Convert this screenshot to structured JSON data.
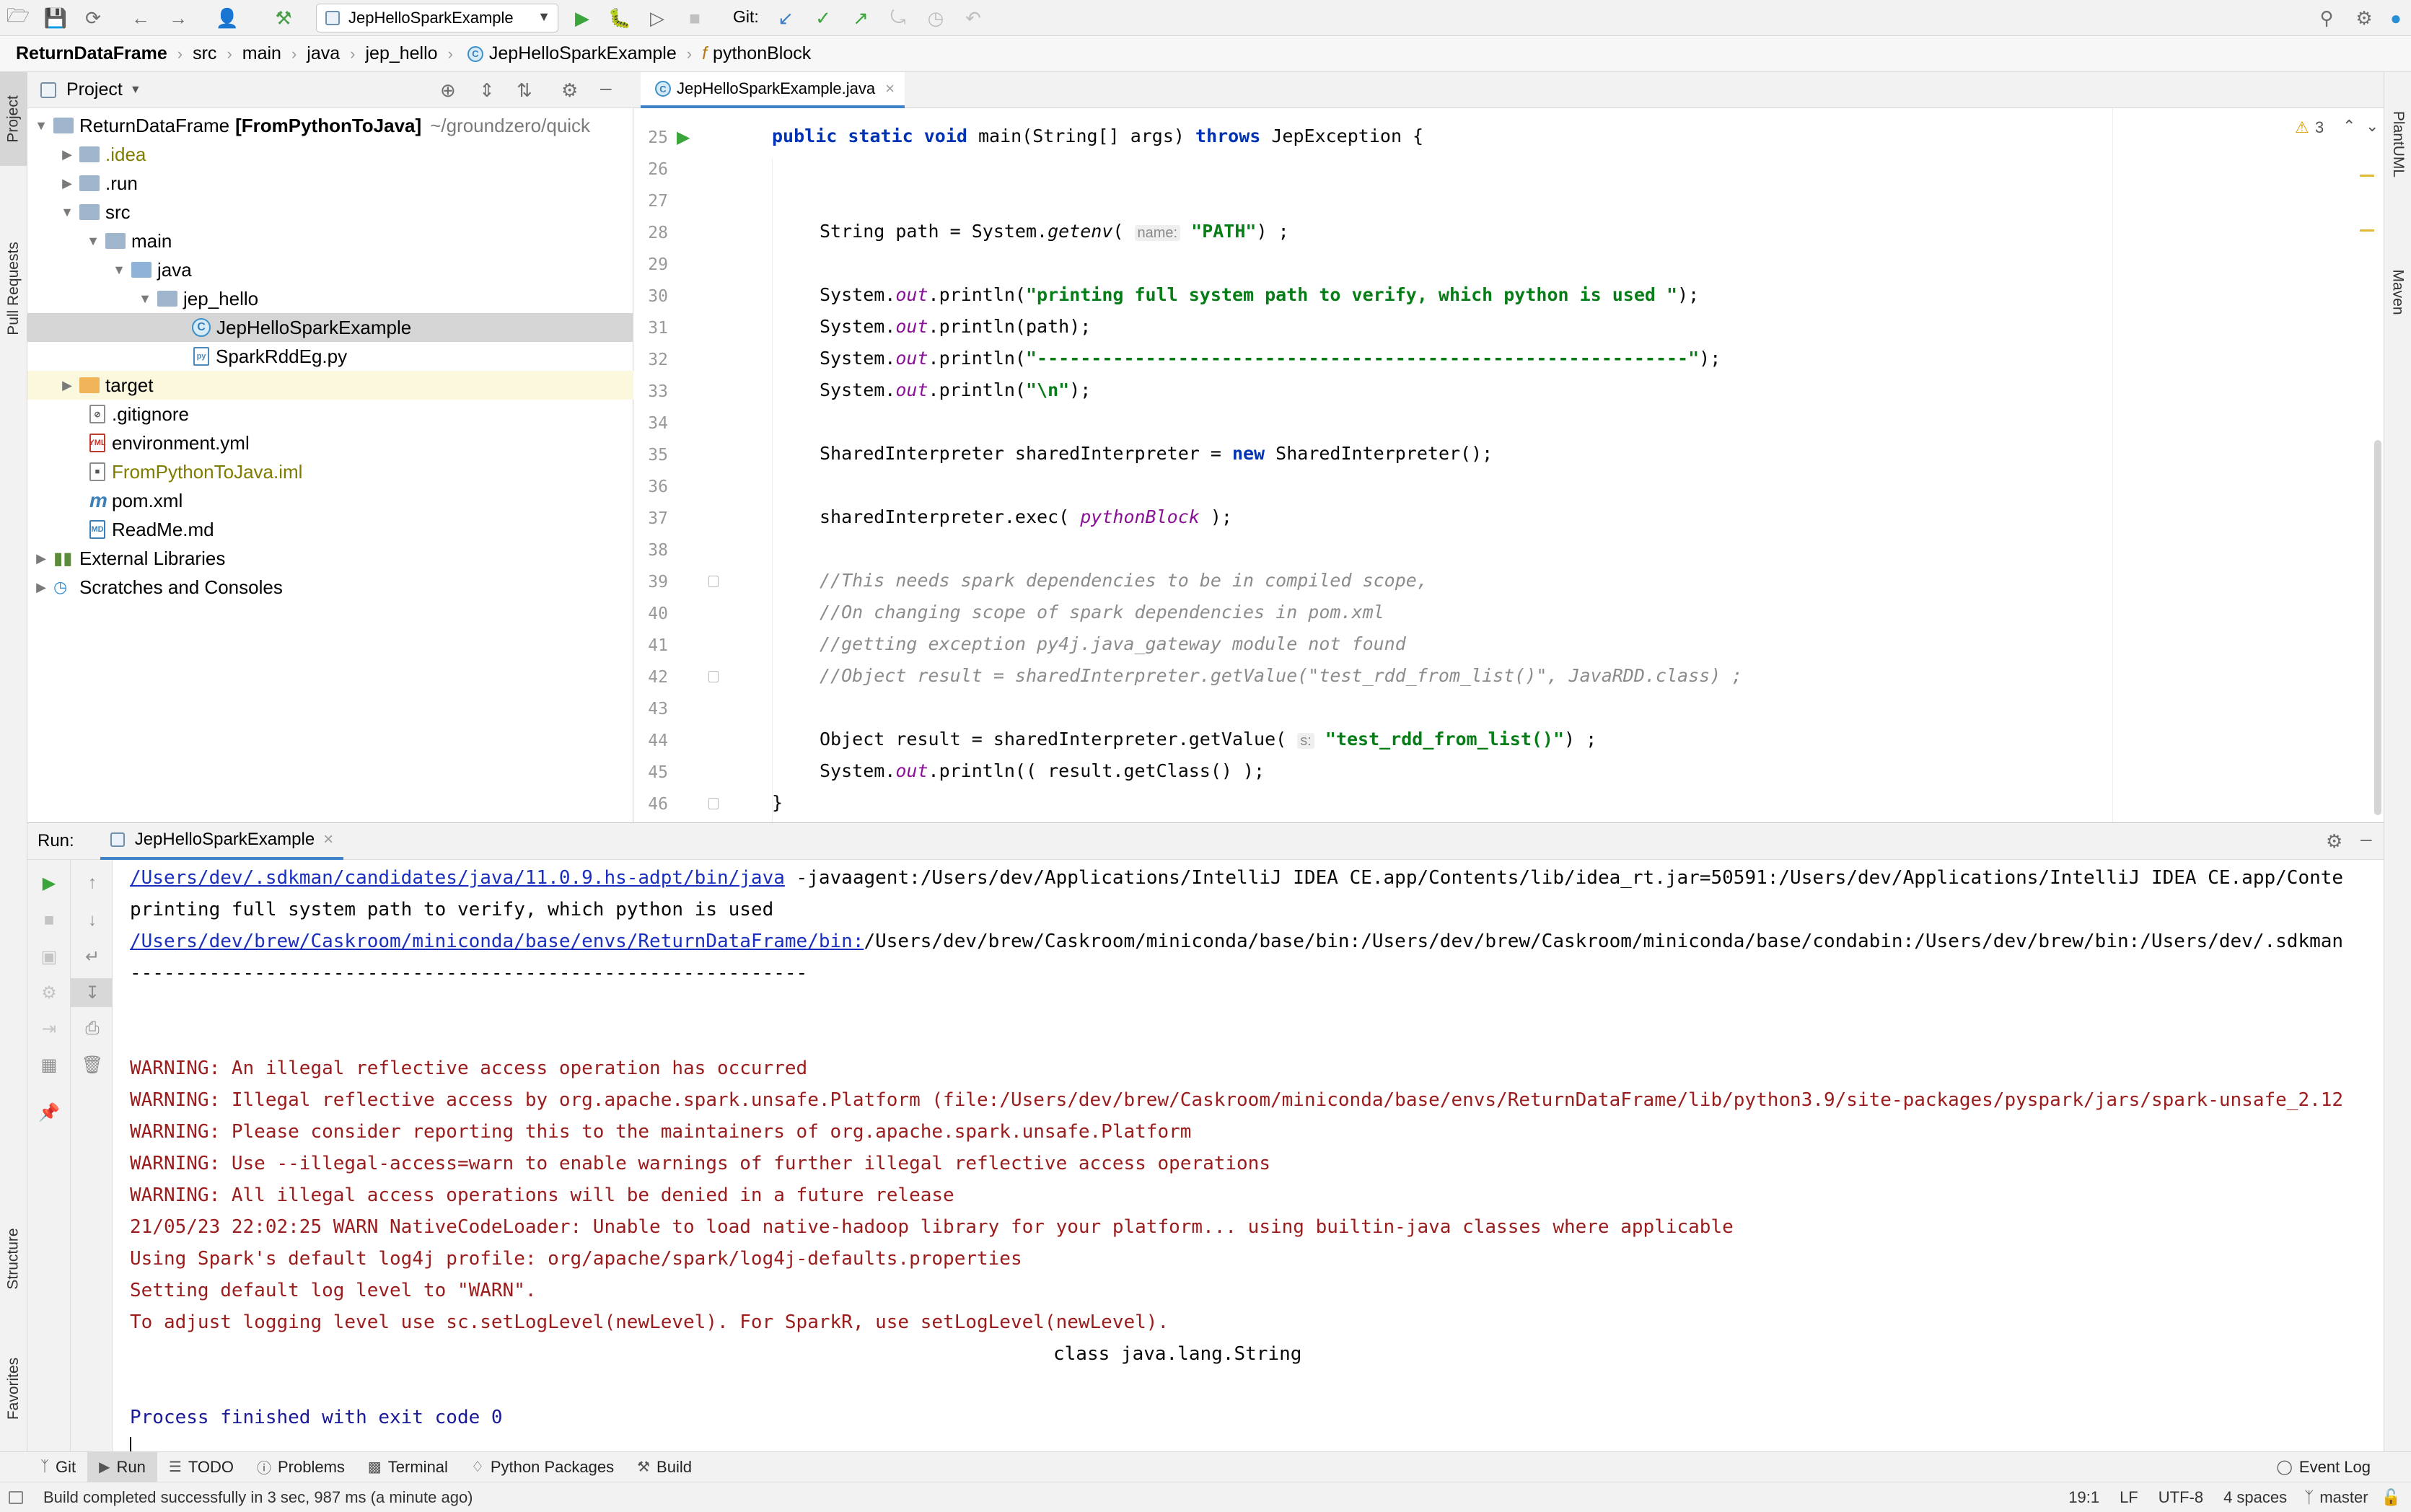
{
  "toolbar": {
    "run_config": "JepHelloSparkExample",
    "git_label": "Git:"
  },
  "breadcrumb": [
    "ReturnDataFrame",
    "src",
    "main",
    "java",
    "jep_hello",
    "JepHelloSparkExample",
    "pythonBlock"
  ],
  "left_stripe": {
    "project": "Project",
    "pull_requests": "Pull Requests",
    "structure": "Structure",
    "favorites": "Favorites"
  },
  "right_stripe": {
    "plantuml": "PlantUML",
    "maven": "Maven"
  },
  "project_panel": {
    "title": "Project",
    "tree": [
      {
        "label": "ReturnDataFrame",
        "bold_suffix": "[FromPythonToJava]",
        "path": "~/groundzero/quick"
      },
      {
        "label": ".idea"
      },
      {
        "label": ".run"
      },
      {
        "label": "src"
      },
      {
        "label": "main"
      },
      {
        "label": "java"
      },
      {
        "label": "jep_hello"
      },
      {
        "label": "JepHelloSparkExample"
      },
      {
        "label": "SparkRddEg.py"
      },
      {
        "label": "target"
      },
      {
        "label": ".gitignore"
      },
      {
        "label": "environment.yml"
      },
      {
        "label": "FromPythonToJava.iml"
      },
      {
        "label": "pom.xml"
      },
      {
        "label": "ReadMe.md"
      },
      {
        "label": "External Libraries"
      },
      {
        "label": "Scratches and Consoles"
      }
    ]
  },
  "editor": {
    "tab": "JepHelloSparkExample.java",
    "warnings": "3",
    "line_numbers": [
      "25",
      "26",
      "27",
      "28",
      "29",
      "30",
      "31",
      "32",
      "33",
      "34",
      "35",
      "36",
      "37",
      "38",
      "39",
      "40",
      "41",
      "42",
      "43",
      "44",
      "45",
      "46"
    ],
    "code": {
      "l25_kw": "public static void ",
      "l25_a": "main(String[] args) ",
      "l25_kw2": "throws ",
      "l25_b": "JepException {",
      "l28_a": "String path = System.",
      "l28_m": "getenv",
      "l28_b": "( ",
      "l28_hint": "name:",
      "l28_str": "\"PATH\"",
      "l28_c": ") ;",
      "out": "out",
      "sys": "System.",
      "println": ".println(",
      "l30_str": "\"printing full system path to verify, which python is used \"",
      "end": ");",
      "l31_arg": "path",
      "l32_str": "\"------------------------------------------------------------\"",
      "l33_str": "\"\\n\"",
      "l35_a": "SharedInterpreter sharedInterpreter = ",
      "l35_kw": "new ",
      "l35_b": "SharedInterpreter();",
      "l37_a": "sharedInterpreter.exec( ",
      "l37_f": "pythonBlock",
      "l37_b": " );",
      "l39": "//This needs spark dependencies to be in compiled scope,",
      "l40": "//On changing scope of spark dependencies in pom.xml",
      "l41": "//getting exception py4j.java_gateway module not found",
      "l42": "//Object result = sharedInterpreter.getValue(\"test_rdd_from_list()\", JavaRDD.class) ;",
      "l44_a": "Object result = sharedInterpreter.getValue( ",
      "l44_hint": "s:",
      "l44_str": "\"test_rdd_from_list()\"",
      "l44_b": ") ;",
      "l45_b": "( result.getClass() );",
      "l46": "}"
    }
  },
  "run_panel": {
    "label": "Run:",
    "tab": "JepHelloSparkExample",
    "console": {
      "l1_link": "/Users/dev/.sdkman/candidates/java/11.0.9.hs-adpt/bin/java",
      "l1_rest": " -javaagent:/Users/dev/Applications/IntelliJ IDEA CE.app/Contents/lib/idea_rt.jar=50591:/Users/dev/Applications/IntelliJ IDEA CE.app/Conte",
      "l2": "printing full system path to verify, which python is used",
      "l3_link": "/Users/dev/brew/Caskroom/miniconda/base/envs/ReturnDataFrame/bin:",
      "l3_rest": "/Users/dev/brew/Caskroom/miniconda/base/bin:/Users/dev/brew/Caskroom/miniconda/base/condabin:/Users/dev/brew/bin:/Users/dev/.sdkman",
      "l4": "------------------------------------------------------------",
      "w1": "WARNING: An illegal reflective access operation has occurred",
      "w2": "WARNING: Illegal reflective access by org.apache.spark.unsafe.Platform (file:/Users/dev/brew/Caskroom/miniconda/base/envs/ReturnDataFrame/lib/python3.9/site-packages/pyspark/jars/spark-unsafe_2.12",
      "w3": "WARNING: Please consider reporting this to the maintainers of org.apache.spark.unsafe.Platform",
      "w4": "WARNING: Use --illegal-access=warn to enable warnings of further illegal reflective access operations",
      "w5": "WARNING: All illegal access operations will be denied in a future release",
      "w6": "21/05/23 22:02:25 WARN NativeCodeLoader: Unable to load native-hadoop library for your platform... using builtin-java classes where applicable",
      "w7": "Using Spark's default log4j profile: org/apache/spark/log4j-defaults.properties",
      "w8": "Setting default log level to \"WARN\".",
      "w9": "To adjust logging level use sc.setLogLevel(newLevel). For SparkR, use setLogLevel(newLevel).",
      "result": "class java.lang.String",
      "exit": "Process finished with exit code 0"
    }
  },
  "bottom_tabs": [
    "Git",
    "Run",
    "TODO",
    "Problems",
    "Terminal",
    "Python Packages",
    "Build"
  ],
  "event_log": "Event Log",
  "status": {
    "message": "Build completed successfully in 3 sec, 987 ms (a minute ago)",
    "position": "19:1",
    "line_sep": "LF",
    "encoding": "UTF-8",
    "indent": "4 spaces",
    "branch": "master"
  }
}
